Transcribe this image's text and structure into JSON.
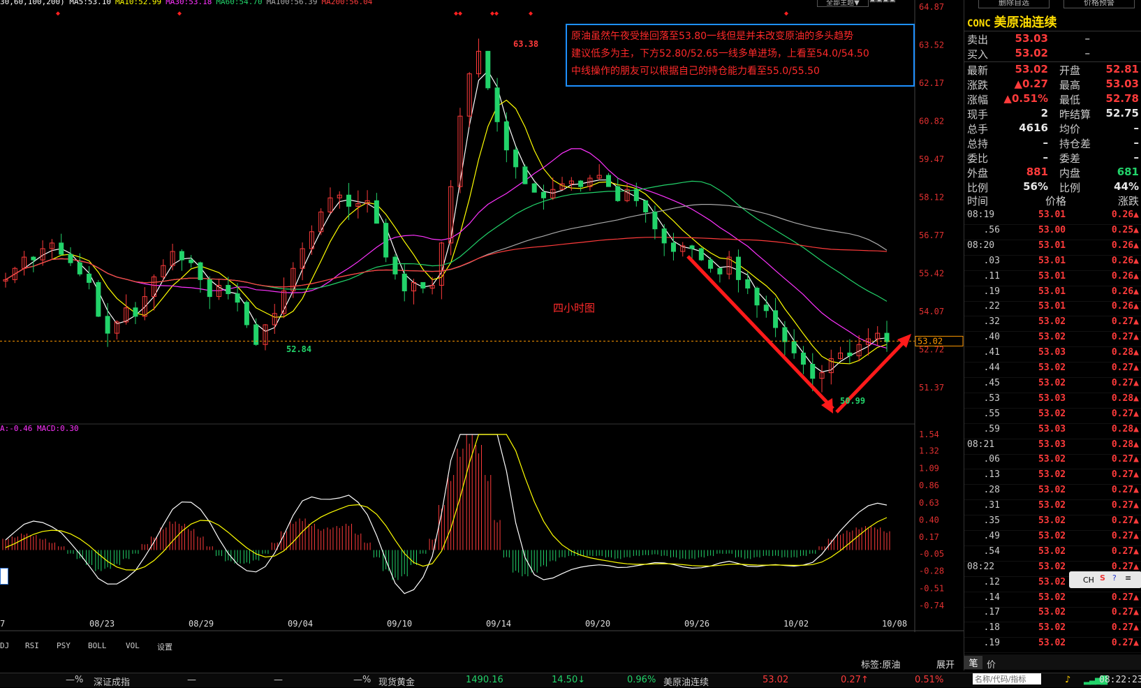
{
  "legend": {
    "ma_line": "30,60,100,200) MA5:53.10",
    "ma10": "MA10:52.99",
    "ma30": "MA30:53.18",
    "ma60": "MA60:54.70",
    "ma100": "MA100:56.39",
    "ma200": "MA200:56.04",
    "macd_line": "A:-0.46  MACD:0.30"
  },
  "toolbar": {
    "theme_btn": "全部主题▼",
    "delete_btn": "删除自选",
    "alert_btn": "价格预警"
  },
  "annotation": {
    "lines": [
      "原油虽然午夜受挫回落至53.80一线但是并未改变原油的多头趋势",
      "建议低多为主，下方52.80/52.65一线多单进场，上看至54.0/54.50",
      "中线操作的朋友可以根据自己的持仓能力看至55.0/55.50"
    ],
    "chart_note": "四小时图"
  },
  "chart_data": {
    "type": "candlestick",
    "price_axis": [
      "64.87",
      "63.52",
      "62.17",
      "60.82",
      "59.47",
      "58.12",
      "56.77",
      "55.42",
      "54.07",
      "52.72",
      "51.37"
    ],
    "price_range": [
      50.6,
      64.87
    ],
    "current_price_tag": "53.02",
    "price_marks": {
      "high": "63.38",
      "low_left": "52.84",
      "low_right": "50.99"
    },
    "macd_axis": [
      "1.54",
      "1.32",
      "1.09",
      "0.86",
      "0.63",
      "0.40",
      "0.17",
      "-0.05",
      "-0.28",
      "-0.51",
      "-0.74"
    ],
    "x_labels": [
      "7",
      "08/23",
      "08/29",
      "09/04",
      "09/10",
      "09/14",
      "09/20",
      "09/26",
      "10/02",
      "10/08"
    ],
    "close_path": [
      55.2,
      55.6,
      56.0,
      55.9,
      56.3,
      56.5,
      56.1,
      55.8,
      55.4,
      55.1,
      53.9,
      53.3,
      53.7,
      54.2,
      53.9,
      54.6,
      55.3,
      55.7,
      56.2,
      55.9,
      55.8,
      55.2,
      54.6,
      55.0,
      54.7,
      54.4,
      53.6,
      52.9,
      53.6,
      54.0,
      54.8,
      55.6,
      56.3,
      56.9,
      57.6,
      58.1,
      58.2,
      57.8,
      57.9,
      58.0,
      57.2,
      56.0,
      55.4,
      54.8,
      55.1,
      54.9,
      55.0,
      56.5,
      58.5,
      61.0,
      62.5,
      63.3,
      62.0,
      60.8,
      59.8,
      59.2,
      58.6,
      58.3,
      58.1,
      58.4,
      58.6,
      58.7,
      58.5,
      58.8,
      58.9,
      58.5,
      58.0,
      58.4,
      58.0,
      57.6,
      57.0,
      56.5,
      56.2,
      56.4,
      56.3,
      55.9,
      55.6,
      55.4,
      56.0,
      55.2,
      54.9,
      54.3,
      54.1,
      53.5,
      53.0,
      52.6,
      52.2,
      51.7,
      51.9,
      52.4,
      52.6,
      52.5,
      52.9,
      53.1,
      53.3,
      53.0
    ],
    "macd_hist": [
      0.15,
      0.18,
      0.22,
      0.2,
      0.15,
      0.1,
      0.05,
      -0.05,
      -0.12,
      -0.2,
      -0.28,
      -0.25,
      -0.2,
      -0.12,
      -0.05,
      0.08,
      0.18,
      0.3,
      0.38,
      0.35,
      0.28,
      0.18,
      0.05,
      -0.08,
      -0.15,
      -0.18,
      -0.18,
      -0.14,
      -0.05,
      0.1,
      0.25,
      0.38,
      0.42,
      0.35,
      0.28,
      0.3,
      0.32,
      0.35,
      0.22,
      0.1,
      -0.1,
      -0.28,
      -0.4,
      -0.35,
      -0.2,
      -0.05,
      0.15,
      0.6,
      1.0,
      1.35,
      1.54,
      1.4,
      1.0,
      0.4,
      -0.1,
      -0.3,
      -0.35,
      -0.3,
      -0.22,
      -0.15,
      -0.1,
      -0.08,
      -0.08,
      -0.08,
      -0.08,
      -0.1,
      -0.12,
      -0.1,
      -0.08,
      -0.07,
      -0.06,
      -0.08,
      -0.1,
      -0.12,
      -0.12,
      -0.1,
      -0.08,
      -0.05,
      -0.05,
      -0.1,
      -0.12,
      -0.1,
      -0.08,
      -0.08,
      -0.1,
      -0.1,
      -0.08,
      -0.05,
      0.05,
      0.15,
      0.22,
      0.26,
      0.3,
      0.32,
      0.3,
      0.25
    ]
  },
  "quote": {
    "code": "CONC",
    "name": "美原油连续",
    "sell_label": "卖出",
    "sell_price": "53.03",
    "sell_vol": "–",
    "buy_label": "买入",
    "buy_price": "53.02",
    "buy_vol": "–",
    "rows": [
      {
        "k": "最新",
        "v": "53.02",
        "vc": "red",
        "k2": "开盘",
        "v2": "52.81",
        "v2c": "red"
      },
      {
        "k": "涨跌",
        "v": "▲0.27",
        "vc": "red",
        "k2": "最高",
        "v2": "53.03",
        "v2c": "red"
      },
      {
        "k": "涨幅",
        "v": "▲0.51%",
        "vc": "red",
        "k2": "最低",
        "v2": "52.78",
        "v2c": "red"
      },
      {
        "k": "现手",
        "v": "2",
        "vc": "white",
        "k2": "昨结算",
        "v2": "52.75",
        "v2c": "white"
      },
      {
        "k": "总手",
        "v": "4616",
        "vc": "white",
        "k2": "均价",
        "v2": "–",
        "v2c": "white"
      },
      {
        "k": "总持",
        "v": "–",
        "vc": "white",
        "k2": "持仓差",
        "v2": "–",
        "v2c": "white"
      },
      {
        "k": "委比",
        "v": "–",
        "vc": "white",
        "k2": "委差",
        "v2": "–",
        "v2c": "white"
      },
      {
        "k": "外盘",
        "v": "881",
        "vc": "red",
        "k2": "内盘",
        "v2": "681",
        "v2c": "green"
      },
      {
        "k": "比例",
        "v": "56%",
        "vc": "white",
        "k2": "比例",
        "v2": "44%",
        "v2c": "white"
      }
    ],
    "tick_header": {
      "time": "时间",
      "price": "价格",
      "change": "涨跌"
    },
    "ticks": [
      {
        "t": "08:19",
        "p": "53.01",
        "c": "0.26▲"
      },
      {
        "t": "   .56",
        "p": "53.00",
        "c": "0.25▲"
      },
      {
        "t": "08:20",
        "p": "53.01",
        "c": "0.26▲"
      },
      {
        "t": "   .03",
        "p": "53.01",
        "c": "0.26▲"
      },
      {
        "t": "   .11",
        "p": "53.01",
        "c": "0.26▲"
      },
      {
        "t": "   .19",
        "p": "53.01",
        "c": "0.26▲"
      },
      {
        "t": "   .22",
        "p": "53.01",
        "c": "0.26▲"
      },
      {
        "t": "   .32",
        "p": "53.02",
        "c": "0.27▲"
      },
      {
        "t": "   .40",
        "p": "53.02",
        "c": "0.27▲"
      },
      {
        "t": "   .41",
        "p": "53.03",
        "c": "0.28▲"
      },
      {
        "t": "   .44",
        "p": "53.02",
        "c": "0.27▲"
      },
      {
        "t": "   .45",
        "p": "53.02",
        "c": "0.27▲"
      },
      {
        "t": "   .53",
        "p": "53.03",
        "c": "0.28▲"
      },
      {
        "t": "   .55",
        "p": "53.02",
        "c": "0.27▲"
      },
      {
        "t": "   .59",
        "p": "53.03",
        "c": "0.28▲"
      },
      {
        "t": "08:21",
        "p": "53.03",
        "c": "0.28▲"
      },
      {
        "t": "   .06",
        "p": "53.02",
        "c": "0.27▲"
      },
      {
        "t": "   .13",
        "p": "53.02",
        "c": "0.27▲"
      },
      {
        "t": "   .28",
        "p": "53.02",
        "c": "0.27▲"
      },
      {
        "t": "   .31",
        "p": "53.02",
        "c": "0.27▲"
      },
      {
        "t": "   .35",
        "p": "53.02",
        "c": "0.27▲"
      },
      {
        "t": "   .49",
        "p": "53.02",
        "c": "0.27▲"
      },
      {
        "t": "   .54",
        "p": "53.02",
        "c": "0.27▲"
      },
      {
        "t": "08:22",
        "p": "53.02",
        "c": "0.27▲"
      },
      {
        "t": "   .12",
        "p": "53.02",
        "c": "0.27▲"
      },
      {
        "t": "   .14",
        "p": "53.02",
        "c": "0.27▲"
      },
      {
        "t": "   .17",
        "p": "53.02",
        "c": "0.27▲"
      },
      {
        "t": "   .18",
        "p": "53.02",
        "c": "0.27▲"
      },
      {
        "t": "   .19",
        "p": "53.02",
        "c": "0.27▲"
      }
    ],
    "tab_label": "标签:原油",
    "expand_btn": "展开",
    "tab_pen": "笔",
    "tab_price": "价"
  },
  "indicator_tabs": [
    "DJ",
    "RSI",
    "PSY",
    "BOLL",
    "VOL",
    "设置"
  ],
  "bottom_bar": {
    "item1_pct": "—%",
    "item2_name": "深证成指",
    "item2_v": "—",
    "item3_pct": "—%",
    "item4_name": "现货黄金",
    "item4_price": "1490.16",
    "item4_chg": "14.50↓",
    "item4_pct": "0.96%",
    "item5_name": "美原油连续",
    "item5_price": "53.02",
    "item5_chg": "0.27↑",
    "item5_pct": "0.51%",
    "search_placeholder": "名称/代码/指标",
    "ime_label": "CH",
    "clock": "08:22:23"
  }
}
